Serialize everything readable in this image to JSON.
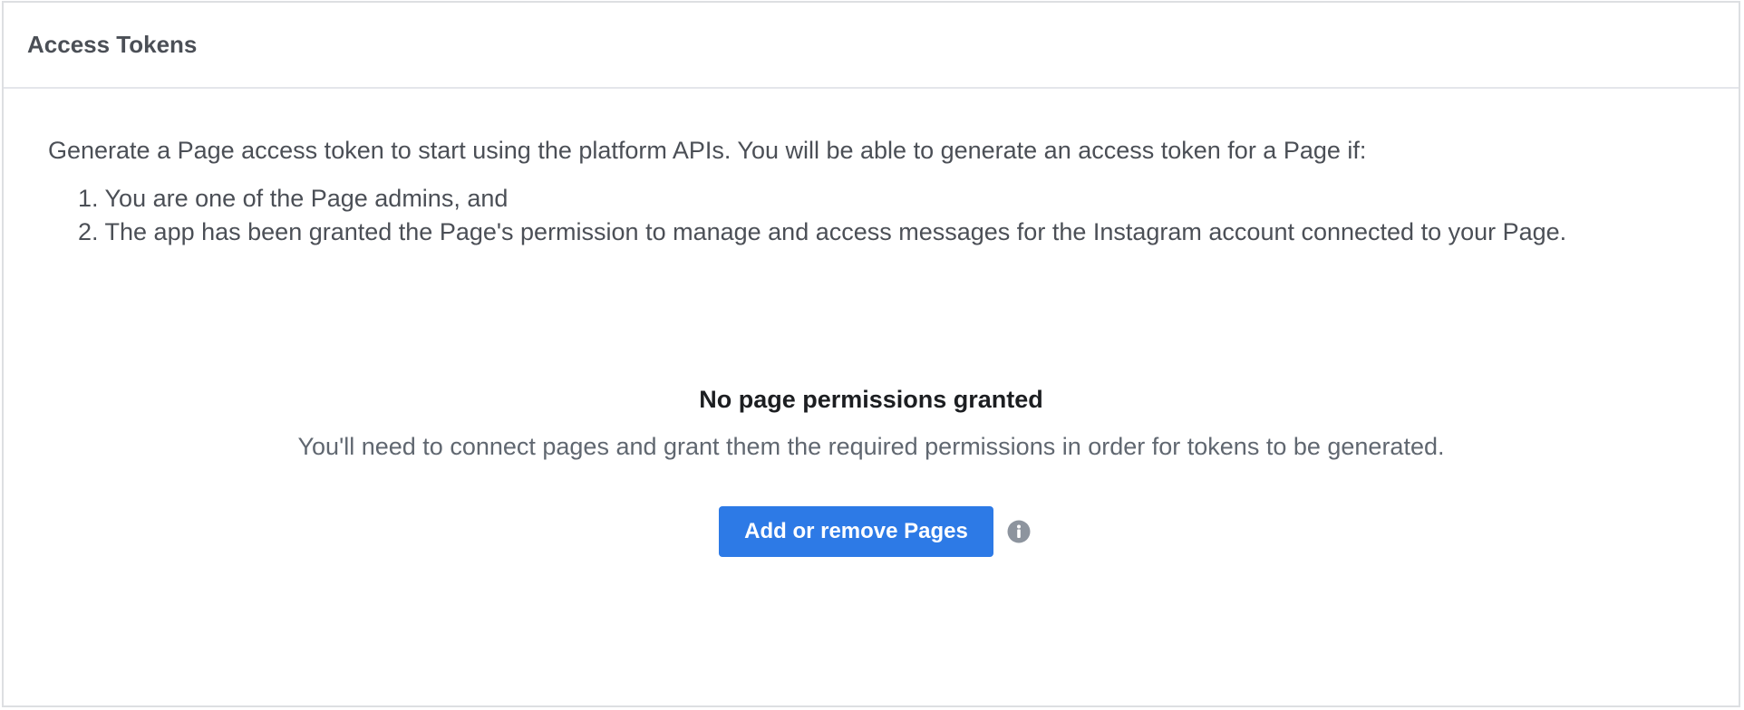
{
  "panel": {
    "title": "Access Tokens"
  },
  "intro": {
    "text": "Generate a Page access token to start using the platform APIs. You will be able to generate an access token for a Page if:",
    "requirements": [
      "1. You are one of the Page admins, and",
      "2. The app has been granted the Page's permission to manage and access messages for the Instagram account connected to your Page."
    ]
  },
  "empty_state": {
    "title": "No page permissions granted",
    "description": "You'll need to connect pages and grant them the required permissions in order for tokens to be generated."
  },
  "actions": {
    "add_remove_label": "Add or remove Pages",
    "info_icon": "info-icon"
  },
  "colors": {
    "accent": "#2d7ae6",
    "border": "#dddfe2",
    "text_secondary": "#4b4f56",
    "icon_gray": "#8d949e"
  }
}
